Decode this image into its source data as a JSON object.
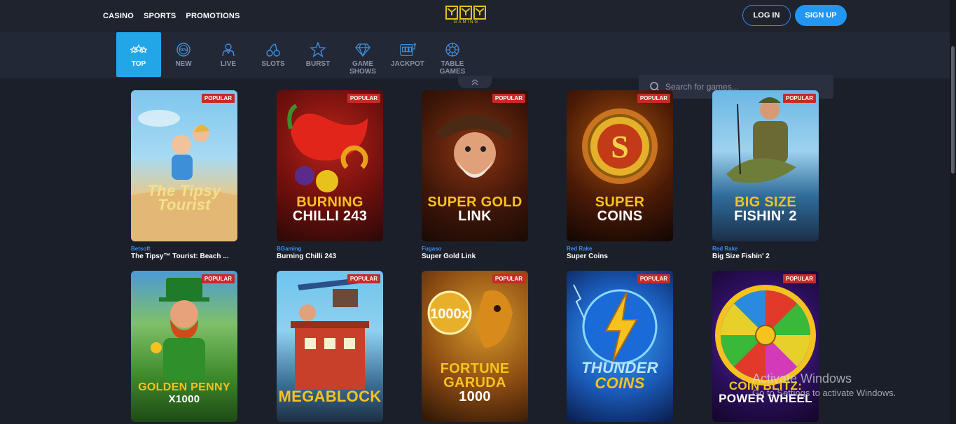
{
  "topnav": {
    "casino": "CASINO",
    "sports": "SPORTS",
    "promotions": "PROMOTIONS"
  },
  "logo": {
    "sub": "GAMING"
  },
  "auth": {
    "login": "LOG IN",
    "signup": "SIGN UP"
  },
  "categories": [
    {
      "label": "TOP",
      "icon": "stars-icon",
      "active": true
    },
    {
      "label": "NEW",
      "icon": "new-badge-icon"
    },
    {
      "label": "LIVE",
      "icon": "dealer-icon"
    },
    {
      "label": "SLOTS",
      "icon": "cherries-icon"
    },
    {
      "label": "BURST",
      "icon": "burst-star-icon"
    },
    {
      "label": "GAME SHOWS",
      "icon": "diamond-icon"
    },
    {
      "label": "JACKPOT",
      "icon": "slot-machine-icon"
    },
    {
      "label": "TABLE GAMES",
      "icon": "roulette-icon"
    }
  ],
  "search": {
    "placeholder": "Search for games..."
  },
  "badge": "POPULAR",
  "games": [
    {
      "provider": "Betsoft",
      "name": "The Tipsy™ Tourist: Beach ...",
      "art_line1": "The Tipsy",
      "art_line2": "Tourist",
      "accent": "#f5e08a"
    },
    {
      "provider": "BGaming",
      "name": "Burning Chilli 243",
      "art_line1": "BURNING",
      "art_line2": "CHILLI 243",
      "accent": "#f7c21e"
    },
    {
      "provider": "Fugaso",
      "name": "Super Gold Link",
      "art_line1": "SUPER GOLD",
      "art_line2": "LINK",
      "accent": "#f7c21e"
    },
    {
      "provider": "Red Rake",
      "name": "Super Coins",
      "art_line1": "SUPER",
      "art_line2": "COINS",
      "accent": "#f7c21e"
    },
    {
      "provider": "Red Rake",
      "name": "Big Size Fishin' 2",
      "art_line1": "BIG SIZE",
      "art_line2": "FISHIN' 2",
      "accent": "#f7c21e"
    },
    {
      "provider": "",
      "name": "",
      "art_line1": "GOLDEN PENNY",
      "art_line2": "X1000",
      "accent": "#f7c21e"
    },
    {
      "provider": "",
      "name": "",
      "art_line1": "MEGABLOCK",
      "art_line2": "",
      "accent": "#f7c21e"
    },
    {
      "provider": "",
      "name": "",
      "art_line1": "FORTUNE",
      "art_line2": "GARUDA",
      "art_line3": "1000",
      "accent": "#f7c21e"
    },
    {
      "provider": "",
      "name": "",
      "art_line1": "THUNDER",
      "art_line2": "COINS",
      "accent": "#f7c21e"
    },
    {
      "provider": "",
      "name": "",
      "art_line1": "COIN BLITZ:",
      "art_line2": "POWER WHEEL",
      "accent": "#f7c21e"
    }
  ],
  "watermark": {
    "line1": "Activate Windows",
    "line2": "Go to Settings to activate Windows."
  }
}
